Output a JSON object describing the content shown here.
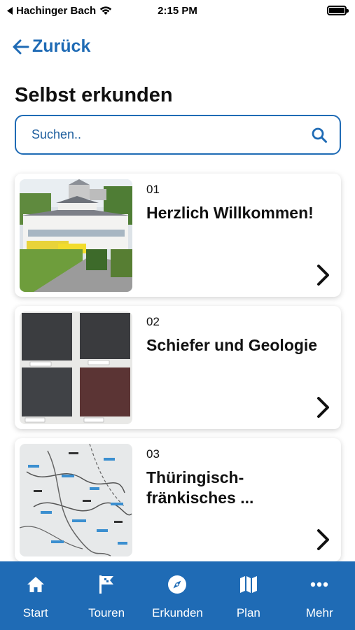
{
  "status_bar": {
    "back_app": "Hachinger Bach",
    "time": "2:15 PM"
  },
  "nav": {
    "back_label": "Zurück"
  },
  "page": {
    "title": "Selbst erkunden"
  },
  "search": {
    "placeholder": "Suchen.."
  },
  "items": [
    {
      "number": "01",
      "title": "Herzlich Willkommen!",
      "thumb": "museum-building-photo"
    },
    {
      "number": "02",
      "title": "Schiefer und Geologie",
      "thumb": "slate-samples-photo"
    },
    {
      "number": "03",
      "title": "Thüringisch-fränkisches ...",
      "thumb": "map-photo"
    }
  ],
  "tabbar": {
    "tabs": [
      {
        "label": "Start",
        "icon": "home-icon"
      },
      {
        "label": "Touren",
        "icon": "flag-icon"
      },
      {
        "label": "Erkunden",
        "icon": "compass-icon"
      },
      {
        "label": "Plan",
        "icon": "map-icon"
      },
      {
        "label": "Mehr",
        "icon": "more-icon"
      }
    ]
  },
  "colors": {
    "accent": "#1f6bb5",
    "background": "#ffffff",
    "text": "#111111"
  }
}
